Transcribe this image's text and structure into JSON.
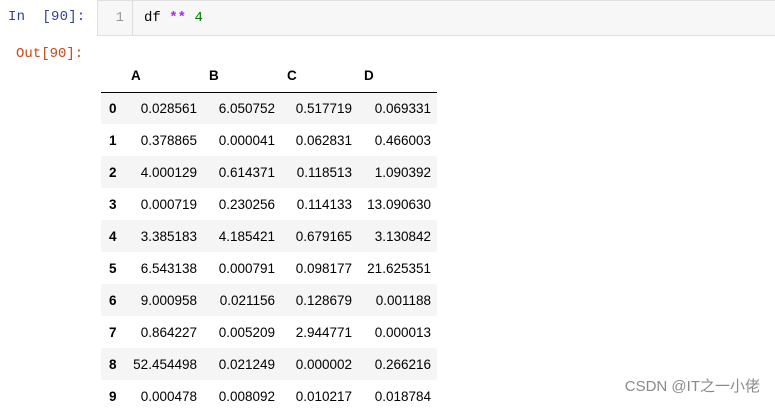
{
  "input_cell": {
    "prompt": "In  [90]:",
    "line_number": "1",
    "code": {
      "var": "df",
      "op": "**",
      "num": "4"
    }
  },
  "output_cell": {
    "prompt": "Out[90]:"
  },
  "dataframe": {
    "columns": [
      "",
      "A",
      "B",
      "C",
      "D"
    ],
    "rows": [
      {
        "index": "0",
        "A": "0.028561",
        "B": "6.050752",
        "C": "0.517719",
        "D": "0.069331"
      },
      {
        "index": "1",
        "A": "0.378865",
        "B": "0.000041",
        "C": "0.062831",
        "D": "0.466003"
      },
      {
        "index": "2",
        "A": "4.000129",
        "B": "0.614371",
        "C": "0.118513",
        "D": "1.090392"
      },
      {
        "index": "3",
        "A": "0.000719",
        "B": "0.230256",
        "C": "0.114133",
        "D": "13.090630"
      },
      {
        "index": "4",
        "A": "3.385183",
        "B": "4.185421",
        "C": "0.679165",
        "D": "3.130842"
      },
      {
        "index": "5",
        "A": "6.543138",
        "B": "0.000791",
        "C": "0.098177",
        "D": "21.625351"
      },
      {
        "index": "6",
        "A": "9.000958",
        "B": "0.021156",
        "C": "0.128679",
        "D": "0.001188"
      },
      {
        "index": "7",
        "A": "0.864227",
        "B": "0.005209",
        "C": "2.944771",
        "D": "0.000013"
      },
      {
        "index": "8",
        "A": "52.454498",
        "B": "0.021249",
        "C": "0.000002",
        "D": "0.266216"
      },
      {
        "index": "9",
        "A": "0.000478",
        "B": "0.008092",
        "C": "0.010217",
        "D": "0.018784"
      }
    ]
  },
  "watermark": "CSDN @IT之一小佬",
  "colors": {
    "in_prompt": "#303f9f",
    "out_prompt": "#d84315",
    "operator": "#aa22ff",
    "number": "#008000",
    "code_background": "#f7f7f7",
    "row_stripe": "#f5f5f5"
  }
}
